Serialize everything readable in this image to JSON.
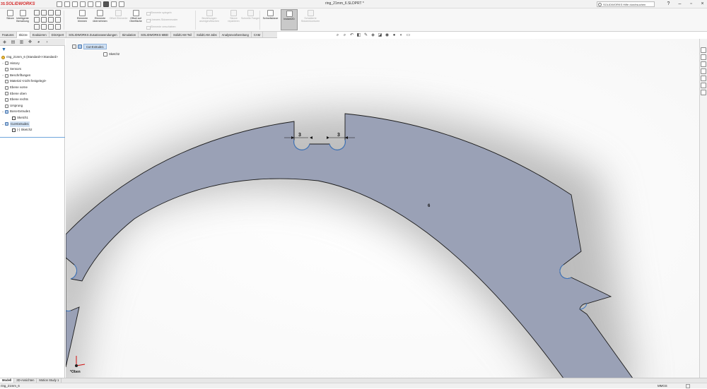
{
  "app": {
    "logo_ds": "3S",
    "logo_text": "SOLIDWORKS"
  },
  "document": {
    "title": "ring_21mm_6.SLDPRT *"
  },
  "help_search": {
    "placeholder": "SOLIDWORKS Hilfe durchsuchen"
  },
  "ribbon": {
    "sketch": "Skizze",
    "smart_dim": "Intelligente Bemaßung",
    "trim": "Elemente trimmen",
    "convert": "Elemente übernehmen",
    "offset": "Offset Elemente",
    "offset_surface": "Offset auf Oberfläche",
    "mirror": "Elemente spiegeln",
    "linear_pattern": "Lineares Skizzenmuster",
    "move": "Elemente verschieben",
    "display_relations": "Beziehungen anzeigen/löschen",
    "repair": "Skizze reparieren",
    "quick_snaps": "Schnelle Fangen",
    "rapid_sketch": "Schnellskizze",
    "instant2d": "Instant2D",
    "shaded_contours": "Schattierte Skizzenkonturen"
  },
  "command_tabs": [
    "Features",
    "Skizze",
    "Evaluieren",
    "DimXpert",
    "SOLIDWORKS Zusatzanwendungen",
    "Simulation",
    "SOLIDWORKS MBD",
    "SolidCAM Teil",
    "SolidCAM Jobs",
    "Analysevorbereitung",
    "CAM"
  ],
  "active_command_tab": "Skizze",
  "feature_tree": {
    "part": "ring_21mm_6 (Standard<<Standard>",
    "items": [
      {
        "label": "History"
      },
      {
        "label": "Sensors"
      },
      {
        "label": "Beschriftungen"
      },
      {
        "label": "Material <nicht festgelegt>"
      },
      {
        "label": "Ebene vorne"
      },
      {
        "label": "Ebene oben"
      },
      {
        "label": "Ebene rechts"
      },
      {
        "label": "Ursprung"
      },
      {
        "label": "Boss-Extrude1"
      },
      {
        "label": "Sketch1"
      },
      {
        "label": "Cut-Extrude1"
      },
      {
        "label": "(-) Sketch2"
      }
    ]
  },
  "breadcrumb": {
    "feature": "Cut-Extrude1",
    "sketch": "Sketch2"
  },
  "dimensions": [
    {
      "text": "3",
      "meaning": "slot width left"
    },
    {
      "text": "3",
      "meaning": "slot width right"
    },
    {
      "text": "6",
      "meaning": "ring width"
    }
  ],
  "colors": {
    "part_fill": "#9aa1b6",
    "part_edge": "#1c1c1c",
    "fillet_blue": "#3d78c4",
    "triad_red": "#d01010"
  },
  "triad": {
    "label": "*Oben"
  },
  "bottom_tabs": [
    "Modell",
    "3D-Ansichten",
    "Motion Study 1"
  ],
  "active_bottom_tab": "Modell",
  "status": {
    "left": "ring_21mm_6",
    "units": "MMGS"
  }
}
